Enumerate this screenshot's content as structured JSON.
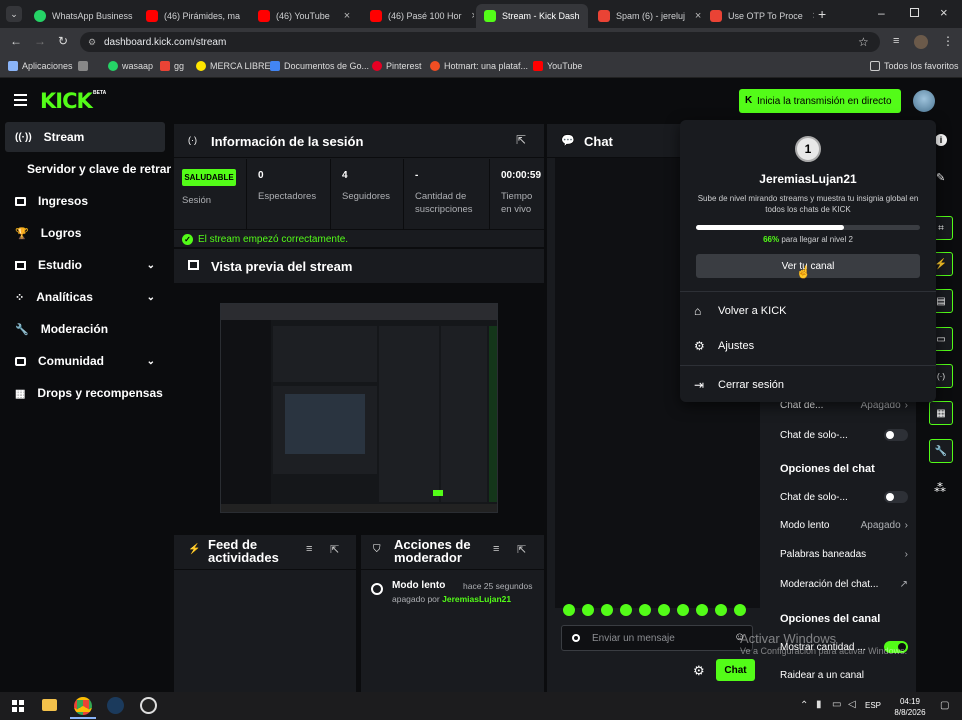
{
  "browser": {
    "tabs": [
      {
        "label": "WhatsApp Business",
        "color": "#25d366"
      },
      {
        "label": "(46) Pirámides, ma",
        "color": "#ff0000"
      },
      {
        "label": "(46) YouTube",
        "color": "#ff0000"
      },
      {
        "label": "(46) Pasé 100 Hor",
        "color": "#ff0000"
      },
      {
        "label": "Stream - Kick Dash",
        "color": "#53fc18"
      },
      {
        "label": "Spam (6) - jereluj",
        "color": "#ea4335"
      },
      {
        "label": "Use OTP To Proce",
        "color": "#ea4335"
      }
    ],
    "url": "dashboard.kick.com/stream",
    "bookmarks": [
      "Aplicaciones",
      "wasaap",
      "gg",
      "MERCA LIBRE",
      "Documentos de Go...",
      "Pinterest",
      "Hotmart: una plataf...",
      "YouTube"
    ],
    "all_bookmarks": "Todos los favoritos"
  },
  "kick": {
    "logo": "KICK",
    "beta": "BETA",
    "go_live": "Inicia la transmisión en directo"
  },
  "sidebar": {
    "items": [
      {
        "label": "Stream",
        "icon": "stream-icon"
      },
      {
        "label": "Servidor y clave de retransm",
        "icon": ""
      },
      {
        "label": "Ingresos",
        "icon": "money-icon"
      },
      {
        "label": "Logros",
        "icon": "trophy-icon"
      },
      {
        "label": "Estudio",
        "icon": "studio-icon"
      },
      {
        "label": "Analíticas",
        "icon": "analytics-icon"
      },
      {
        "label": "Moderación",
        "icon": "wrench-icon"
      },
      {
        "label": "Comunidad",
        "icon": "community-icon"
      },
      {
        "label": "Drops y recompensas",
        "icon": "gift-icon"
      }
    ]
  },
  "session": {
    "title": "Información de la sesión",
    "status_badge": "SALUDABLE",
    "status_label": "Sesión",
    "stats": [
      {
        "value": "0",
        "label": "Espectadores"
      },
      {
        "value": "4",
        "label": "Seguidores"
      },
      {
        "value": "-",
        "label": "Cantidad de suscripciones"
      },
      {
        "value": "00:00:59",
        "label": "Tiempo en vivo"
      }
    ],
    "health_message": "El stream empezó correctamente."
  },
  "preview": {
    "title": "Vista previa del stream"
  },
  "activity": {
    "title": "Feed de actividades"
  },
  "modactions": {
    "title": "Acciones de moderador",
    "event_title": "Modo lento",
    "event_time": "hace 25 segundos",
    "event_prefix": "apagado por",
    "event_user": "JeremiasLujan21"
  },
  "chat": {
    "title": "Chat",
    "placeholder": "Enviar un mensaje",
    "send_label": "Chat"
  },
  "user_menu": {
    "level": "1",
    "username": "JeremiasLujan21",
    "description": "Sube de nivel mirando streams y muestra tu insignia global en todos los chats de KICK",
    "progress_fraction": 0.66,
    "progress_pct": "66%",
    "progress_text": "para llegar al nivel 2",
    "view_channel": "Ver tu canal",
    "back_to_kick": "Volver a KICK",
    "settings": "Ajustes",
    "logout": "Cerrar sesión"
  },
  "chat_settings": {
    "row1_label": "Chat de...",
    "row1_value": "Apagado",
    "row2_label": "Chat de solo-...",
    "section_chat": "Opciones del chat",
    "row3_label": "Chat de solo-...",
    "row4_label": "Modo lento",
    "row4_value": "Apagado",
    "row5_label": "Palabras baneadas",
    "row6_label": "Moderación del chat...",
    "section_channel": "Opciones del canal",
    "row7_label": "Mostrar cantidad ...",
    "row8_label": "Raidear a un canal"
  },
  "windows": {
    "watermark_title": "Activar Windows",
    "watermark_sub": "Ve a Configuración para activar Windows.",
    "lang": "ESP",
    "time": "04:19",
    "date": "8/8/2026"
  },
  "colors": {
    "accent": "#53fc18",
    "bg": "#0b0c0e",
    "panel": "#191b1f"
  }
}
